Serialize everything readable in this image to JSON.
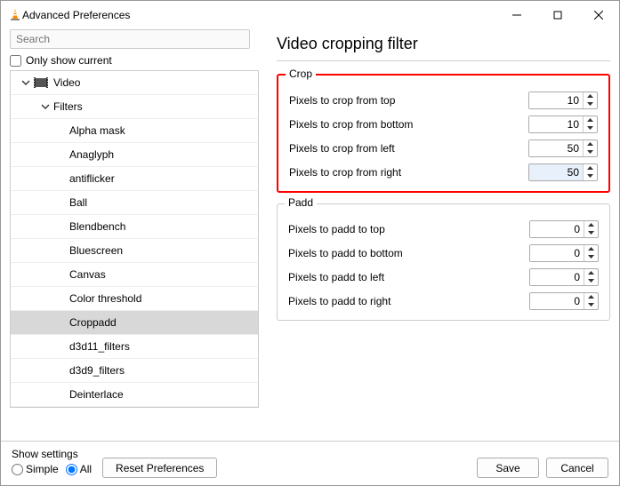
{
  "titlebar": {
    "title": "Advanced Preferences"
  },
  "search": {
    "placeholder": "Search"
  },
  "only_show": {
    "label": "Only show current"
  },
  "tree": {
    "video": "Video",
    "filters": "Filters",
    "items": [
      "Alpha mask",
      "Anaglyph",
      "antiflicker",
      "Ball",
      "Blendbench",
      "Bluescreen",
      "Canvas",
      "Color threshold",
      "Croppadd",
      "d3d11_filters",
      "d3d9_filters",
      "Deinterlace"
    ]
  },
  "panel": {
    "title": "Video cropping filter",
    "crop": {
      "legend": "Crop",
      "top": {
        "label": "Pixels to crop from top",
        "value": "10"
      },
      "bottom": {
        "label": "Pixels to crop from bottom",
        "value": "10"
      },
      "left": {
        "label": "Pixels to crop from left",
        "value": "50"
      },
      "right": {
        "label": "Pixels to crop from right",
        "value": "50"
      }
    },
    "padd": {
      "legend": "Padd",
      "top": {
        "label": "Pixels to padd to top",
        "value": "0"
      },
      "bottom": {
        "label": "Pixels to padd to bottom",
        "value": "0"
      },
      "left": {
        "label": "Pixels to padd to left",
        "value": "0"
      },
      "right": {
        "label": "Pixels to padd to right",
        "value": "0"
      }
    }
  },
  "footer": {
    "show_settings": "Show settings",
    "simple": "Simple",
    "all": "All",
    "reset": "Reset Preferences",
    "save": "Save",
    "cancel": "Cancel"
  }
}
